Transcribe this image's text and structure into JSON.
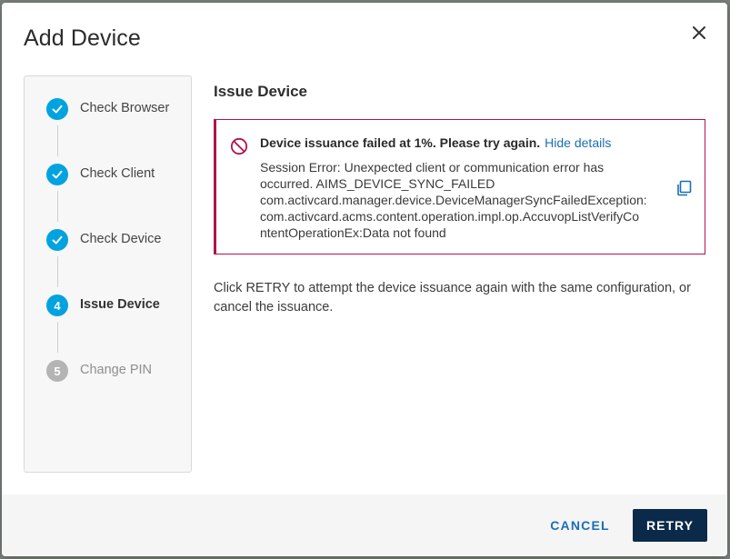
{
  "dialog": {
    "title": "Add Device",
    "close_icon": "close-icon"
  },
  "stepper": {
    "steps": [
      {
        "label": "Check Browser",
        "state": "complete",
        "marker": ""
      },
      {
        "label": "Check Client",
        "state": "complete",
        "marker": ""
      },
      {
        "label": "Check Device",
        "state": "complete",
        "marker": ""
      },
      {
        "label": "Issue Device",
        "state": "active",
        "marker": "4"
      },
      {
        "label": "Change PIN",
        "state": "pending",
        "marker": "5"
      }
    ]
  },
  "main": {
    "title": "Issue Device",
    "error": {
      "headline": "Device issuance failed at 1%. Please try again.",
      "toggle_label": "Hide details",
      "details_lines": [
        "Session Error: Unexpected client or communication error has",
        "occurred. AIMS_DEVICE_SYNC_FAILED",
        "com.activcard.manager.device.DeviceManagerSyncFailedException:",
        "com.activcard.acms.content.operation.impl.op.AccuvopListVerifyCo",
        "ntentOperationEx:Data not found"
      ],
      "icon": "blocked-icon",
      "copy_icon": "copy-icon"
    },
    "help_text": "Click RETRY to attempt the device issuance again with the same configuration, or cancel the issuance."
  },
  "footer": {
    "cancel_label": "CANCEL",
    "retry_label": "RETRY"
  },
  "colors": {
    "accent": "#00a3e0",
    "error": "#b0134e",
    "link": "#1a6fb5",
    "primary_button": "#0b2a4a",
    "pending_step": "#b4b4b4"
  }
}
